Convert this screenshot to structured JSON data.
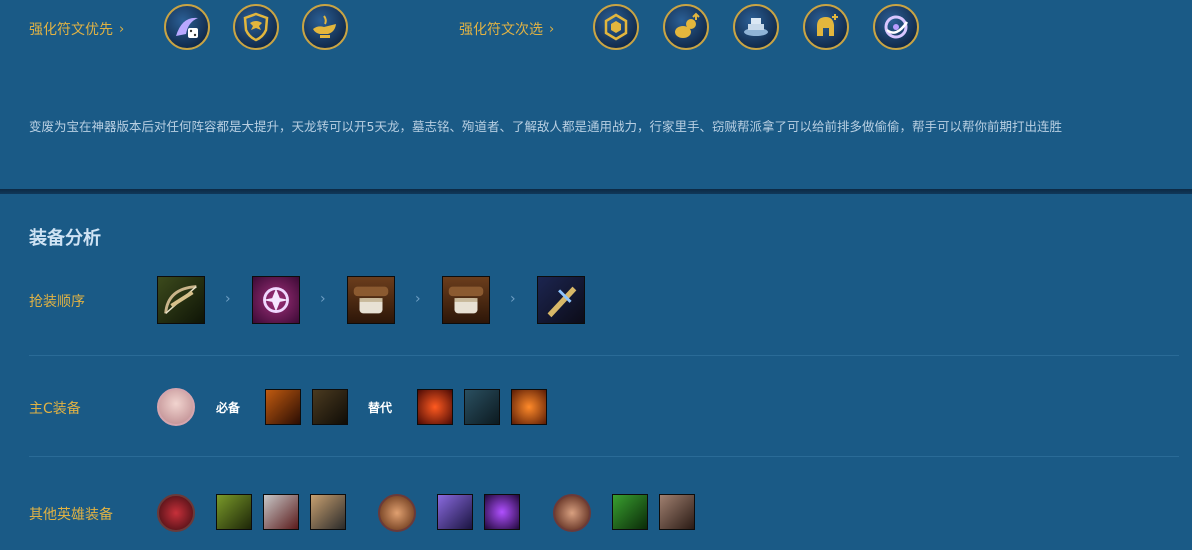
{
  "runes": {
    "priority_label": "强化符文优先",
    "alternative_label": "强化符文次选",
    "priority": [
      {
        "icon": "dice-rune-icon"
      },
      {
        "icon": "dragon-shield-rune-icon"
      },
      {
        "icon": "lamp-rune-icon"
      }
    ],
    "alternative": [
      {
        "icon": "hexagon-rune-icon"
      },
      {
        "icon": "money-bag-rune-icon"
      },
      {
        "icon": "anvil-rune-icon"
      },
      {
        "icon": "helmet-plus-rune-icon"
      },
      {
        "icon": "spiral-rune-icon"
      }
    ],
    "description": "变废为宝在神器版本后对任何阵容都是大提升，天龙转可以开5天龙，墓志铭、殉道者、了解敌人都是通用战力，行家里手、窃贼帮派拿了可以给前排多做偷偷，帮手可以帮你前期打出连胜"
  },
  "equipment": {
    "title": "装备分析",
    "order_label": "抢装顺序",
    "order_items": [
      {
        "icon": "bow-item-icon"
      },
      {
        "icon": "purple-amulet-item-icon"
      },
      {
        "icon": "gauntlet-item-icon"
      },
      {
        "icon": "gauntlet-item-icon"
      },
      {
        "icon": "golden-blade-item-icon"
      }
    ],
    "main_label": "主C装备",
    "required_tag": "必备",
    "alternative_tag": "替代",
    "other_label": "其他英雄装备",
    "colors": {
      "accent": "#e0b244",
      "background": "#1a5a86"
    }
  }
}
